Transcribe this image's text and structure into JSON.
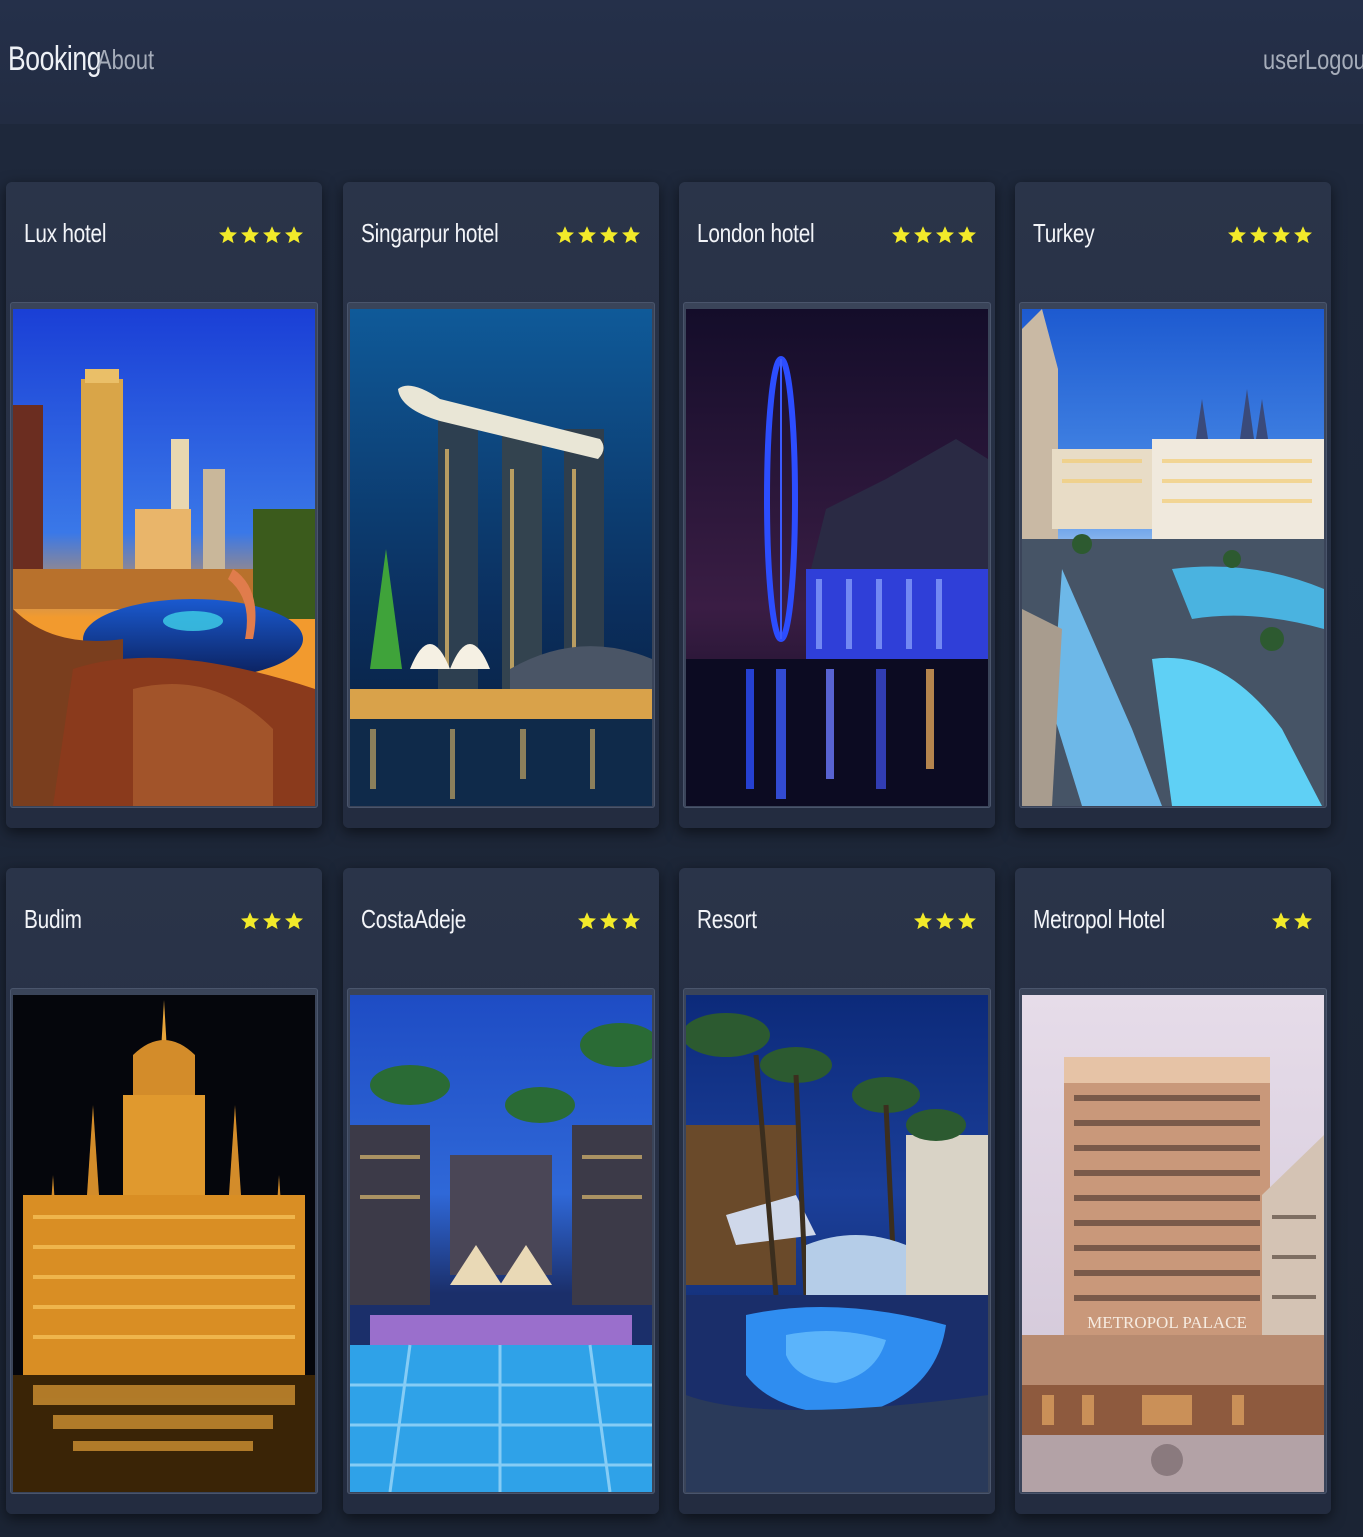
{
  "navbar": {
    "brand": "Booking",
    "about": "About",
    "user": "user",
    "logout": "Logout"
  },
  "hotels": [
    {
      "name": "Lux hotel",
      "stars": 4,
      "photo": "las-vegas-resort-night-photo"
    },
    {
      "name": "Singarpur hotel",
      "stars": 4,
      "photo": "marina-bay-sands-night-photo"
    },
    {
      "name": "London hotel",
      "stars": 4,
      "photo": "london-eye-night-photo"
    },
    {
      "name": "Turkey",
      "stars": 4,
      "photo": "turkish-palace-hotel-photo"
    },
    {
      "name": "Budim",
      "stars": 3,
      "photo": "budapest-parliament-night-photo"
    },
    {
      "name": "CostaAdeje",
      "stars": 3,
      "photo": "costa-adeje-pool-night-photo"
    },
    {
      "name": "Resort",
      "stars": 3,
      "photo": "tropical-resort-pool-photo"
    },
    {
      "name": "Metropol Hotel",
      "stars": 2,
      "photo": "metropol-palace-hotel-photo"
    }
  ],
  "photo_signage": {
    "metropol": "METROPOL PALACE"
  },
  "colors": {
    "star": "#f2ea2a",
    "navbar": "#25304a",
    "background": "#1c2536",
    "card": "#2a3449"
  }
}
